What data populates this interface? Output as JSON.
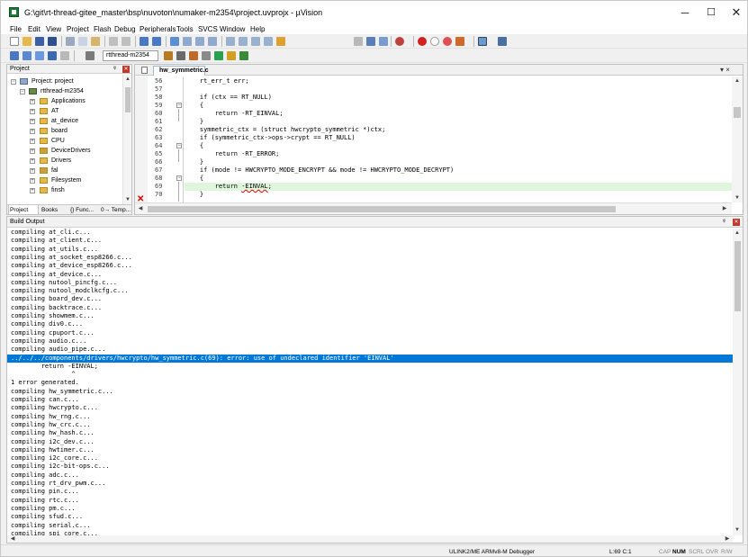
{
  "window": {
    "title": "G:\\git\\rt-thread-gitee_master\\bsp\\nuvoton\\numaker-m2354\\project.uvprojx - µVision",
    "min_glyph": "─",
    "max_glyph": "☐",
    "close_glyph": "✕"
  },
  "menu": [
    "File",
    "Edit",
    "View",
    "Project",
    "Flash",
    "Debug",
    "Peripherals",
    "Tools",
    "SVCS",
    "Window",
    "Help"
  ],
  "toolbar": {
    "target": "rtthread-m2354",
    "icons": [
      "new-file-icon",
      "open-file-icon",
      "save-icon",
      "save-all-icon",
      "cut-icon",
      "copy-icon",
      "paste-icon",
      "undo-icon",
      "redo-icon",
      "nav-back-icon",
      "nav-forward-icon",
      "bookmark-icon",
      "prev-bookmark-icon",
      "next-bookmark-icon",
      "clear-bookmarks-icon",
      "indent-icon",
      "unindent-icon",
      "comment-icon",
      "uncomment-icon",
      "find-in-files-icon",
      "find-icon",
      "debug-start-icon",
      "breakpoint-icon",
      "breakpoint-disable-icon",
      "breakpoint-kill-icon",
      "view-icon",
      "config-icon"
    ]
  },
  "project_panel": {
    "title": "Project",
    "pin": "ᵠ",
    "close": "✕",
    "root_label": "Project: project",
    "target_label": "rtthread-m2354",
    "groups": [
      "Applications",
      "AT",
      "at_device",
      "board",
      "CPU",
      "DeviceDrivers",
      "Drivers",
      "fal",
      "Filesystem",
      "finsh"
    ],
    "tabs": [
      "Project",
      "Books",
      "{} Func...",
      "0→ Temp..."
    ]
  },
  "editor": {
    "tab_label": "hw_symmetric.c",
    "tab_menu": "▾ ×",
    "lines": [
      {
        "num": "56",
        "code": "    rt_err_t err;"
      },
      {
        "num": "57",
        "code": ""
      },
      {
        "num": "58",
        "code": "    if (ctx == RT_NULL)"
      },
      {
        "num": "59",
        "code": "    {"
      },
      {
        "num": "60",
        "code": "        return -RT_EINVAL;"
      },
      {
        "num": "61",
        "code": "    }"
      },
      {
        "num": "62",
        "code": "    symmetric_ctx = (struct hwcrypto_symmetric *)ctx;"
      },
      {
        "num": "63",
        "code": "    if (symmetric_ctx->ops->crypt == RT_NULL)"
      },
      {
        "num": "64",
        "code": "    {"
      },
      {
        "num": "65",
        "code": "        return -RT_ERROR;"
      },
      {
        "num": "66",
        "code": "    }"
      },
      {
        "num": "67",
        "code": "    if (mode != HWCRYPTO_MODE_ENCRYPT && mode != HWCRYPTO_MODE_DECRYPT)"
      },
      {
        "num": "68",
        "code": "    {"
      },
      {
        "num": "69",
        "code_pre": "        return ",
        "code_err": "-EINVAL",
        "code_post": ";"
      },
      {
        "num": "70",
        "code": "    }"
      }
    ],
    "error_marker": "✕"
  },
  "build_output": {
    "title": "Build Output",
    "lines": [
      "compiling at_cli.c...",
      "compiling at_client.c...",
      "compiling at_utils.c...",
      "compiling at_socket_esp8266.c...",
      "compiling at_device_esp8266.c...",
      "compiling at_device.c...",
      "compiling nutool_pincfg.c...",
      "compiling nutool_modclkcfg.c...",
      "compiling board_dev.c...",
      "compiling backtrace.c...",
      "compiling showmem.c...",
      "compiling div0.c...",
      "compiling cpuport.c...",
      "compiling audio.c...",
      "compiling audio_pipe.c...",
      "../../../components/drivers/hwcrypto/hw_symmetric.c(69): error: use of undeclared identifier 'EINVAL'",
      "        return -EINVAL;",
      "                ^",
      "1 error generated.",
      "compiling hw_symmetric.c...",
      "compiling can.c...",
      "compiling hwcrypto.c...",
      "compiling hw_rng.c...",
      "compiling hw_crc.c...",
      "compiling hw_hash.c...",
      "compiling i2c_dev.c...",
      "compiling hwtimer.c...",
      "compiling i2c_core.c...",
      "compiling i2c-bit-ops.c...",
      "compiling adc.c...",
      "compiling rt_drv_pwm.c...",
      "compiling pin.c...",
      "compiling rtc.c...",
      "compiling pm.c...",
      "compiling sfud.c...",
      "compiling serial.c...",
      "compiling spi_core.c..."
    ],
    "selected_index": 15
  },
  "status": {
    "debugger": "ULINK2/ME ARMv8-M Debugger",
    "position": "L:69 C:1",
    "cap": "CAP",
    "num": "NUM",
    "scrl": "SCRL",
    "ovr": "OVR",
    "rw": "R/W"
  },
  "colors": {
    "selection": "#0078d7",
    "current_line": "#dff5dc",
    "error": "#e00000",
    "keyword": "#0000ff"
  }
}
